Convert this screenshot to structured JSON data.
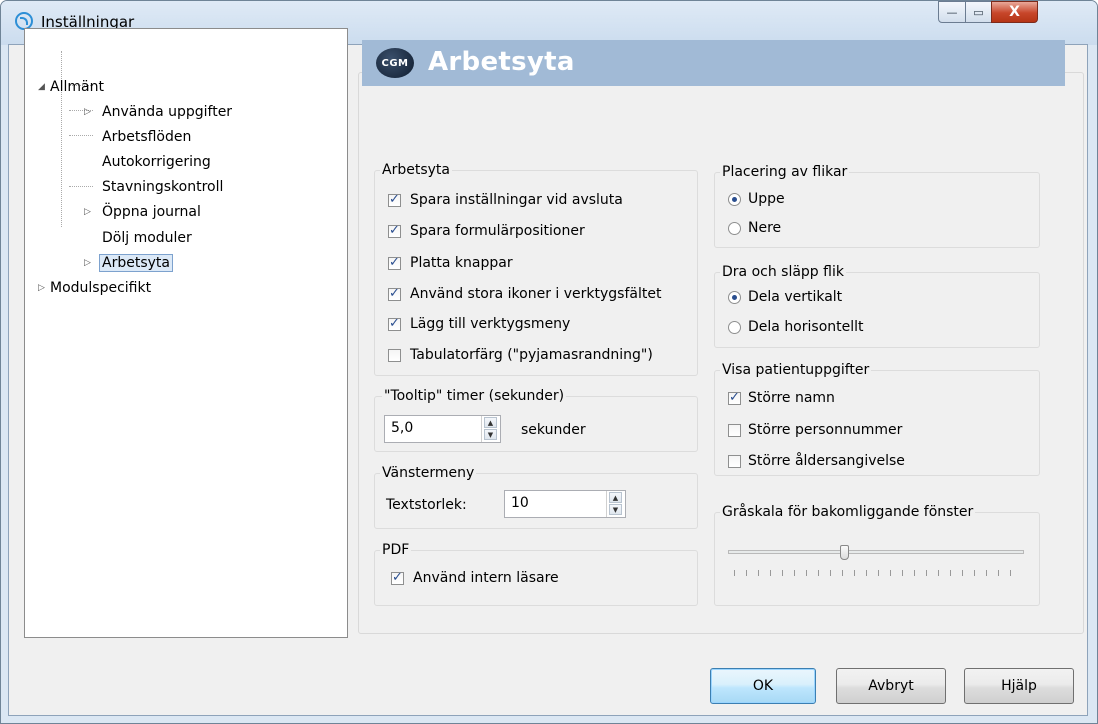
{
  "window": {
    "title": "Inställningar",
    "minimize_icon": "—",
    "maximize_icon": "▭",
    "close_icon": "X"
  },
  "tree": {
    "root_allmant": "Allmänt",
    "items": [
      "Använda uppgifter",
      "Arbetsflöden",
      "Autokorrigering",
      "Stavningskontroll",
      "Öppna journal",
      "Dölj moduler",
      "Arbetsyta"
    ],
    "root_modulspecifikt": "Modulspecifikt",
    "selected": "Arbetsyta"
  },
  "banner": {
    "logo_text": "CGM",
    "title": "Arbetsyta"
  },
  "arbetsyta_group": {
    "label": "Arbetsyta",
    "options": [
      {
        "label": "Spara inställningar vid avsluta",
        "checked": true
      },
      {
        "label": "Spara formulärpositioner",
        "checked": true
      },
      {
        "label": "Platta knappar",
        "checked": true
      },
      {
        "label": "Använd stora ikoner i verktygsfältet",
        "checked": true
      },
      {
        "label": "Lägg till verktygsmeny",
        "checked": true
      },
      {
        "label": "Tabulatorfärg (\"pyjamasrandning\")",
        "checked": false
      }
    ]
  },
  "tooltip_group": {
    "label": "\"Tooltip\" timer (sekunder)",
    "value": "5,0",
    "unit": "sekunder"
  },
  "vanstermeny_group": {
    "label": "Vänstermeny",
    "field_label": "Textstorlek:",
    "value": "10"
  },
  "pdf_group": {
    "label": "PDF",
    "option_label": "Använd intern läsare",
    "checked": true
  },
  "flikar_group": {
    "label": "Placering av flikar",
    "options": [
      "Uppe",
      "Nere"
    ],
    "selected": "Uppe"
  },
  "dra_group": {
    "label": "Dra och släpp flik",
    "options": [
      "Dela vertikalt",
      "Dela horisontellt"
    ],
    "selected": "Dela vertikalt"
  },
  "patient_group": {
    "label": "Visa patientuppgifter",
    "options": [
      {
        "label": "Större namn",
        "checked": true
      },
      {
        "label": "Större personnummer",
        "checked": false
      },
      {
        "label": "Större åldersangivelse",
        "checked": false
      }
    ]
  },
  "graskala_group": {
    "label": "Gråskala för bakomliggande fönster",
    "slider_value_fraction": 0.38
  },
  "buttons": {
    "ok": "OK",
    "cancel": "Avbryt",
    "help": "Hjälp"
  }
}
